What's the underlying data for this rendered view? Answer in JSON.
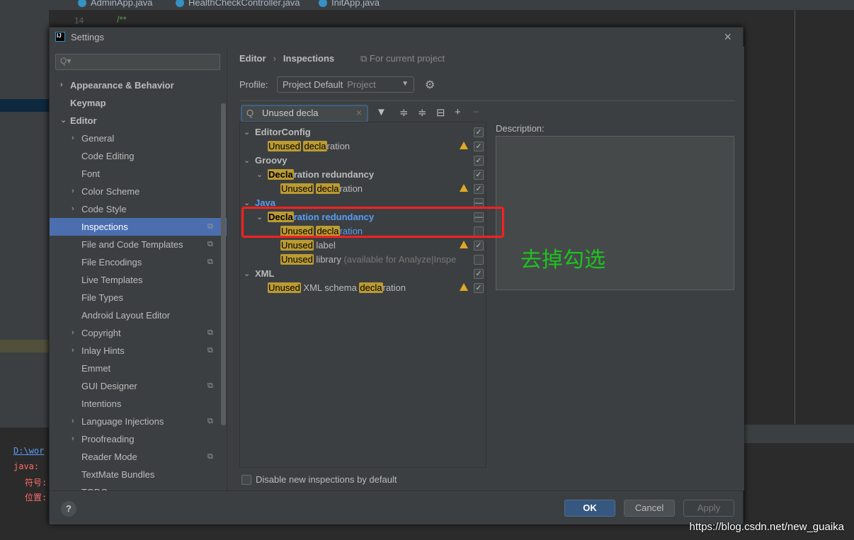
{
  "ide": {
    "tabs": [
      "AdminApp.java",
      "HealthCheckController.java",
      "InitApp.java"
    ],
    "line_number": "14",
    "code": "/**",
    "console": {
      "path": "D:\\wor",
      "java": "java:",
      "symbol": "符号:",
      "location": "位置:"
    }
  },
  "dialog": {
    "title": "Settings",
    "logo": "IJ"
  },
  "sidebar": {
    "search_placeholder": "Q▾",
    "items": [
      {
        "label": "Appearance & Behavior",
        "level": 0,
        "bold": true,
        "arrow": "›"
      },
      {
        "label": "Keymap",
        "level": 0,
        "bold": true
      },
      {
        "label": "Editor",
        "level": 0,
        "bold": true,
        "arrow": "⌄"
      },
      {
        "label": "General",
        "level": 1,
        "arrow": "›"
      },
      {
        "label": "Code Editing",
        "level": 1
      },
      {
        "label": "Font",
        "level": 1
      },
      {
        "label": "Color Scheme",
        "level": 1,
        "arrow": "›"
      },
      {
        "label": "Code Style",
        "level": 1,
        "arrow": "›"
      },
      {
        "label": "Inspections",
        "level": 1,
        "selected": true,
        "project": true
      },
      {
        "label": "File and Code Templates",
        "level": 1,
        "project": true
      },
      {
        "label": "File Encodings",
        "level": 1,
        "project": true
      },
      {
        "label": "Live Templates",
        "level": 1
      },
      {
        "label": "File Types",
        "level": 1
      },
      {
        "label": "Android Layout Editor",
        "level": 1
      },
      {
        "label": "Copyright",
        "level": 1,
        "arrow": "›",
        "project": true
      },
      {
        "label": "Inlay Hints",
        "level": 1,
        "arrow": "›",
        "project": true
      },
      {
        "label": "Emmet",
        "level": 1
      },
      {
        "label": "GUI Designer",
        "level": 1,
        "project": true
      },
      {
        "label": "Intentions",
        "level": 1
      },
      {
        "label": "Language Injections",
        "level": 1,
        "arrow": "›",
        "project": true
      },
      {
        "label": "Proofreading",
        "level": 1,
        "arrow": "›"
      },
      {
        "label": "Reader Mode",
        "level": 1,
        "project": true
      },
      {
        "label": "TextMate Bundles",
        "level": 1
      },
      {
        "label": "TODO",
        "level": 1
      }
    ]
  },
  "content": {
    "breadcrumb": [
      "Editor",
      "Inspections"
    ],
    "for_project": "For current project",
    "profile_label": "Profile:",
    "profile_value": "Project Default",
    "profile_scope": "Project",
    "search_value": "Unused decla",
    "tree": [
      {
        "level": 0,
        "group": true,
        "segs": [
          [
            "EditorConfig",
            0
          ]
        ],
        "check": "on"
      },
      {
        "level": 1,
        "segs": [
          [
            "Unused",
            1
          ],
          [
            " ",
            0
          ],
          [
            "decla",
            1
          ],
          [
            "ration",
            0
          ]
        ],
        "warn": true,
        "check": "on"
      },
      {
        "level": 0,
        "group": true,
        "segs": [
          [
            "Groovy",
            0
          ]
        ],
        "check": "on"
      },
      {
        "level": 1,
        "group": true,
        "segs": [
          [
            "Decla",
            1
          ],
          [
            "ration redundancy",
            0
          ]
        ],
        "check": "on"
      },
      {
        "level": 2,
        "segs": [
          [
            "Unused",
            1
          ],
          [
            " ",
            0
          ],
          [
            "decla",
            1
          ],
          [
            "ration",
            0
          ]
        ],
        "warn": true,
        "check": "on"
      },
      {
        "level": 0,
        "group": true,
        "segs": [
          [
            "Java",
            0
          ]
        ],
        "check": "mixed",
        "modified": true
      },
      {
        "level": 1,
        "group": true,
        "segs": [
          [
            "Decla",
            1
          ],
          [
            "ration redundancy",
            0
          ]
        ],
        "check": "mixed",
        "modified": true
      },
      {
        "level": 2,
        "segs": [
          [
            "Unused",
            1
          ],
          [
            " ",
            0
          ],
          [
            "decla",
            1
          ],
          [
            "ration",
            0
          ]
        ],
        "check": "off",
        "modified": true
      },
      {
        "level": 2,
        "segs": [
          [
            "Unused",
            1
          ],
          [
            " label",
            0
          ]
        ],
        "warn": true,
        "check": "on"
      },
      {
        "level": 2,
        "segs": [
          [
            "Unused",
            1
          ],
          [
            " library ",
            0
          ],
          [
            "(available for Analyze|Inspe",
            2
          ]
        ],
        "check": "off"
      },
      {
        "level": 0,
        "group": true,
        "segs": [
          [
            "XML",
            0
          ]
        ],
        "check": "on"
      },
      {
        "level": 1,
        "segs": [
          [
            "Unused",
            1
          ],
          [
            " XML schema ",
            0
          ],
          [
            "decla",
            1
          ],
          [
            "ration",
            0
          ]
        ],
        "warn": true,
        "check": "on"
      }
    ],
    "description_label": "Description:",
    "disable_new": "Disable new inspections by default"
  },
  "annotation": "去掉勾选",
  "buttons": {
    "help": "?",
    "ok": "OK",
    "cancel": "Cancel",
    "apply": "Apply"
  },
  "watermark": "https://blog.csdn.net/new_guaika",
  "colors": {
    "accent": "#4b6eaf",
    "highlight": "#bb9b32",
    "annotation_box": "#ff2020",
    "annotation_text": "#1fc21f",
    "modified": "#589df6"
  }
}
